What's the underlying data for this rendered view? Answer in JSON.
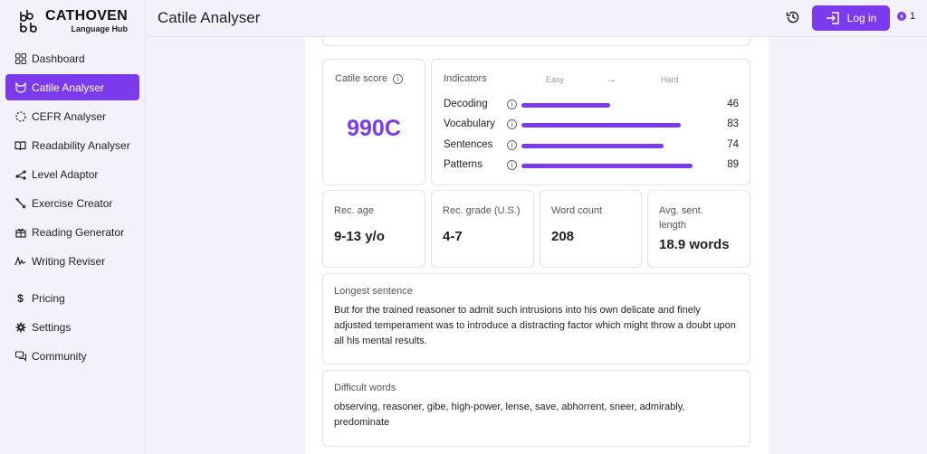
{
  "brand": {
    "name": "CATHOVEN",
    "sub": "Language Hub"
  },
  "sidebar": {
    "items": [
      {
        "label": "Dashboard",
        "icon": "grid-icon"
      },
      {
        "label": "Catile Analyser",
        "icon": "cat-icon",
        "active": true
      },
      {
        "label": "CEFR Analyser",
        "icon": "dotted-circle-icon"
      },
      {
        "label": "Readability Analyser",
        "icon": "book-icon"
      },
      {
        "label": "Level Adaptor",
        "icon": "share-icon"
      },
      {
        "label": "Exercise Creator",
        "icon": "tools-icon"
      },
      {
        "label": "Reading Generator",
        "icon": "gift-icon"
      },
      {
        "label": "Writing Reviser",
        "icon": "signature-icon"
      }
    ],
    "bottom_items": [
      {
        "label": "Pricing",
        "icon": "dollar-icon"
      },
      {
        "label": "Settings",
        "icon": "gear-icon"
      },
      {
        "label": "Community",
        "icon": "chat-icon"
      }
    ]
  },
  "header": {
    "title": "Catile Analyser",
    "login_label": "Log in",
    "credits": "1"
  },
  "score": {
    "label": "Catile score",
    "value": "990C"
  },
  "indicators": {
    "label": "Indicators",
    "easy": "Easy",
    "arrow": "→",
    "hard": "Hard",
    "rows": [
      {
        "name": "Decoding",
        "value": 46
      },
      {
        "name": "Vocabulary",
        "value": 83
      },
      {
        "name": "Sentences",
        "value": 74
      },
      {
        "name": "Patterns",
        "value": 89
      }
    ]
  },
  "stats": [
    {
      "label": "Rec. age",
      "value": "9-13 y/o"
    },
    {
      "label": "Rec. grade (U.S.)",
      "value": "4-7"
    },
    {
      "label": "Word count",
      "value": "208"
    },
    {
      "label": "Avg. sent. length",
      "value": "18.9 words"
    }
  ],
  "longest_sentence": {
    "label": "Longest sentence",
    "text": "But for the trained reasoner to admit such intrusions into his own delicate and finely adjusted temperament was to introduce a distracting factor which might throw a doubt upon all his mental results."
  },
  "difficult_words": {
    "label": "Difficult words",
    "text": "observing, reasoner, gibe, high-power, lense, save, abhorrent, sneer, admirably, predominate"
  },
  "colors": {
    "accent": "#7c3aed",
    "background": "#f3f1fa"
  }
}
